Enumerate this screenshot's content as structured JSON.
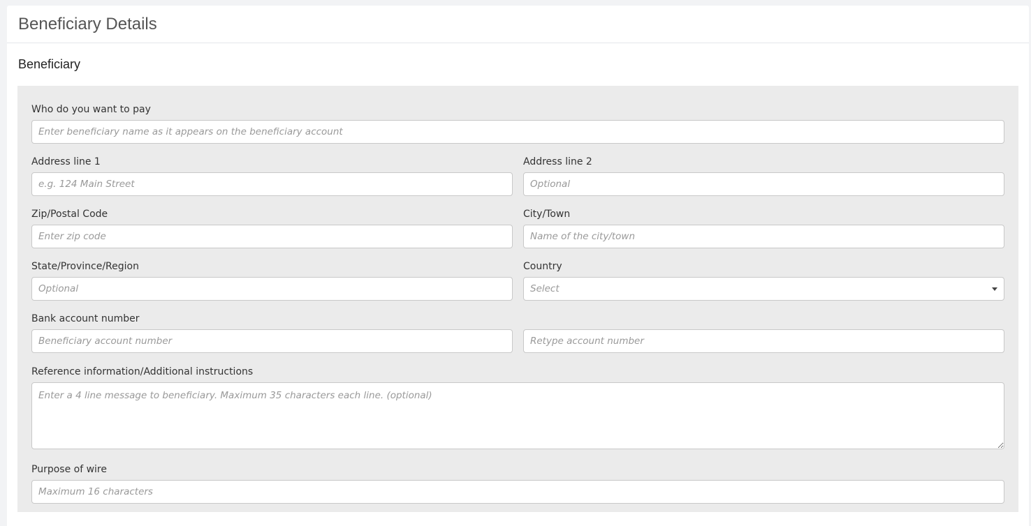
{
  "header": {
    "title": "Beneficiary Details"
  },
  "section": {
    "title": "Beneficiary"
  },
  "form": {
    "who_to_pay": {
      "label": "Who do you want to pay",
      "placeholder": "Enter beneficiary name as it appears on the beneficiary account"
    },
    "address_line_1": {
      "label": "Address line 1",
      "placeholder": "e.g. 124 Main Street"
    },
    "address_line_2": {
      "label": "Address line 2",
      "placeholder": "Optional"
    },
    "zip": {
      "label": "Zip/Postal Code",
      "placeholder": "Enter zip code"
    },
    "city": {
      "label": "City/Town",
      "placeholder": "Name of the city/town"
    },
    "state": {
      "label": "State/Province/Region",
      "placeholder": "Optional"
    },
    "country": {
      "label": "Country",
      "selected": "Select"
    },
    "bank_account": {
      "label": "Bank account number",
      "placeholder": "Beneficiary account number",
      "retype_placeholder": "Retype account number"
    },
    "reference": {
      "label": "Reference information/Additional instructions",
      "placeholder": "Enter a 4 line message to beneficiary. Maximum 35 characters each line. (optional)"
    },
    "purpose": {
      "label": "Purpose of wire",
      "placeholder": "Maximum 16 characters"
    }
  }
}
